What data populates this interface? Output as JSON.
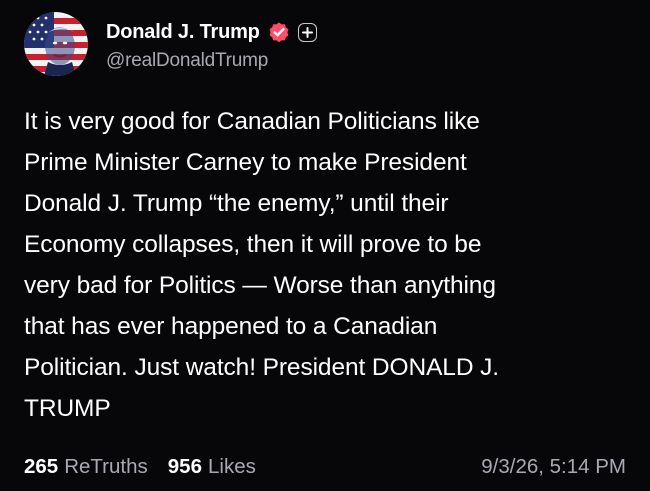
{
  "author": {
    "display_name": "Donald J. Trump",
    "handle": "@realDonaldTrump",
    "avatar_icon": "flag-portrait-avatar",
    "verified_icon": "verified-badge-icon",
    "verified_color": "#ff4d6d",
    "follow_icon": "plus-icon"
  },
  "post": {
    "text": "It is very good for Canadian Politicians like\nPrime Minister Carney to make President\nDonald J. Trump “the enemy,” until their\nEconomy collapses, then it will prove to be\nvery bad for Politics — Worse than anything\nthat has ever happened to a Canadian\nPolitician. Just watch! President DONALD J.\nTRUMP"
  },
  "stats": {
    "retruths_count": "265",
    "retruths_label": "ReTruths",
    "likes_count": "956",
    "likes_label": "Likes"
  },
  "timestamp": "9/3/26, 5:14 PM",
  "colors": {
    "background": "#07070a",
    "text": "#ffffff",
    "muted": "#a9a9b2"
  }
}
